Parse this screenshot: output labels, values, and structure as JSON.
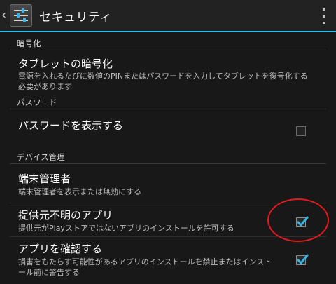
{
  "action_bar": {
    "title": "セキュリティ"
  },
  "sections": {
    "encryption": {
      "header": "暗号化",
      "tablet_encrypt": {
        "title": "タブレットの暗号化",
        "summary": "電源を入れるたびに数値のPINまたはパスワードを入力してタブレットを復号化する必要があります"
      }
    },
    "passwords": {
      "header": "パスワード",
      "show_password": {
        "title": "パスワードを表示する",
        "checked": false
      }
    },
    "device_admin": {
      "header": "デバイス管理",
      "device_administrators": {
        "title": "端末管理者",
        "summary": "端末管理者を表示または無効にする"
      },
      "unknown_sources": {
        "title": "提供元不明のアプリ",
        "summary": "提供元がPlayストアではないアプリのインストールを許可する",
        "checked": true
      },
      "verify_apps": {
        "title": "アプリを確認する",
        "summary": "損害をもたらす可能性があるアプリのインストールを禁止またはインストール前に警告する",
        "checked": true
      }
    }
  },
  "colors": {
    "accent": "#33b5e5",
    "highlight": "#e3191c",
    "background": "#181818"
  }
}
